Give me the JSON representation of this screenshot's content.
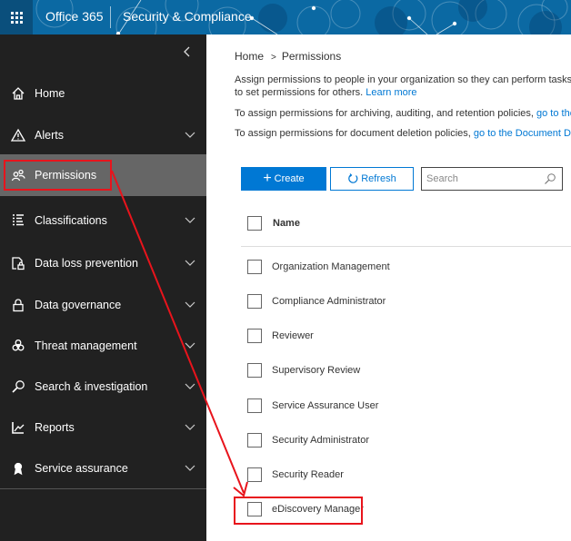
{
  "topbar": {
    "brand": "Office 365",
    "app_title": "Security & Compliance",
    "colors": {
      "background": "#0b69a3",
      "waffle_bg": "#0a4f7c"
    }
  },
  "sidebar": {
    "collapse_icon": "chevron-left-icon",
    "items": [
      {
        "label": "Home",
        "icon": "home-icon",
        "expandable": false,
        "active": false
      },
      {
        "label": "Alerts",
        "icon": "warning-icon",
        "expandable": true,
        "active": false
      },
      {
        "label": "Permissions",
        "icon": "people-icon",
        "expandable": false,
        "active": true
      },
      {
        "label": "Classifications",
        "icon": "list-icon",
        "expandable": true,
        "active": false
      },
      {
        "label": "Data loss prevention",
        "icon": "document-lock-icon",
        "expandable": true,
        "active": false
      },
      {
        "label": "Data governance",
        "icon": "lock-icon",
        "expandable": true,
        "active": false
      },
      {
        "label": "Threat management",
        "icon": "biohazard-icon",
        "expandable": true,
        "active": false
      },
      {
        "label": "Search & investigation",
        "icon": "search-icon",
        "expandable": true,
        "active": false
      },
      {
        "label": "Reports",
        "icon": "chart-icon",
        "expandable": true,
        "active": false
      },
      {
        "label": "Service assurance",
        "icon": "ribbon-icon",
        "expandable": true,
        "active": false
      }
    ]
  },
  "main": {
    "breadcrumb": {
      "home": "Home",
      "separator": ">",
      "current": "Permissions"
    },
    "intro_line1": "Assign permissions to people in your organization so they can perform tasks i",
    "intro_line2": "to set permissions for others. ",
    "learn_more": "Learn more",
    "archiving_text": "To assign permissions for archiving, auditing, and retention policies, ",
    "archiving_link": "go to the",
    "deletion_text": "To assign permissions for document deletion policies, ",
    "deletion_link": "go to the Document De",
    "toolbar": {
      "create_label": "Create",
      "refresh_label": "Refresh",
      "search_placeholder": "Search"
    },
    "list": {
      "header": "Name",
      "rows": [
        "Organization Management",
        "Compliance Administrator",
        "Reviewer",
        "Supervisory Review",
        "Service Assurance User",
        "Security Administrator",
        "Security Reader",
        "eDiscovery Manager"
      ]
    },
    "colors": {
      "accent": "#0078d4",
      "text": "#333333"
    }
  },
  "annotation": {
    "color": "#e8141c",
    "from": "Permissions",
    "to": "eDiscovery Manager"
  }
}
